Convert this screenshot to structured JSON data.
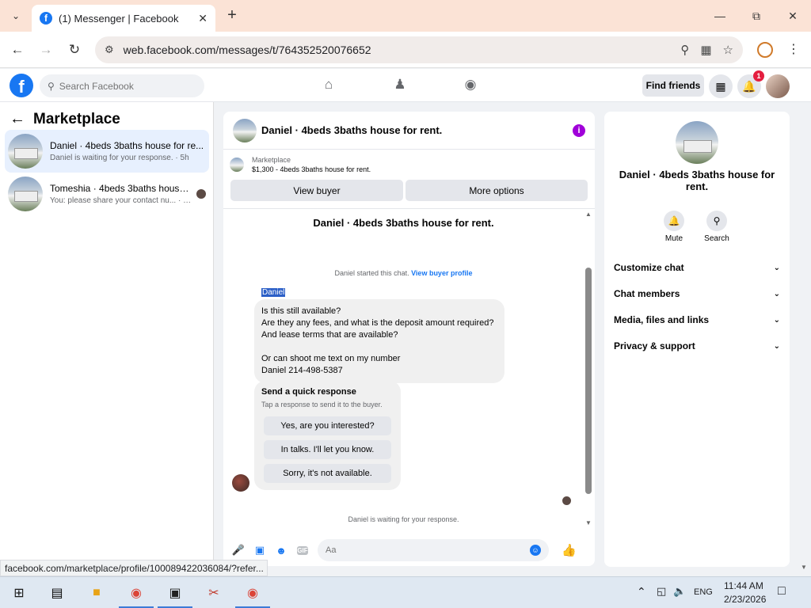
{
  "browser": {
    "tab_title": "(1) Messenger | Facebook",
    "url": "web.facebook.com/messages/t/764352520076652"
  },
  "header": {
    "search_placeholder": "Search Facebook",
    "find_friends": "Find friends",
    "notification_count": "1"
  },
  "sidebar": {
    "title": "Marketplace",
    "threads": [
      {
        "name": "Daniel · 4beds 3baths house for re...",
        "preview": "Daniel is waiting for your response. · 5h"
      },
      {
        "name": "Tomeshia · 4beds 3baths house ...",
        "preview": "You: please share your contact nu... · 2d"
      }
    ]
  },
  "chat": {
    "title": "Daniel · 4beds 3baths house for rent.",
    "listing_category": "Marketplace",
    "listing_desc": "$1,300 - 4beds 3baths house for rent.",
    "view_buyer": "View buyer",
    "more_options": "More options",
    "center_title": "Daniel · 4beds 3baths house for rent.",
    "started_text": "Daniel started this chat. ",
    "view_buyer_profile": "View buyer profile",
    "sender": "Daniel",
    "message_lines": [
      "Is this still available?",
      "Are they any fees, and what is the deposit amount required?",
      "And lease terms that are available?",
      "",
      "Or can shoot me text on my number",
      "Daniel 214-498-5387"
    ],
    "quick_title": "Send a quick response",
    "quick_sub": "Tap a response to send it to the buyer.",
    "quick_responses": [
      "Yes, are you interested?",
      "In talks. I'll let you know.",
      "Sorry, it's not available."
    ],
    "waiting": "Daniel is waiting for your response.",
    "input_placeholder": "Aa"
  },
  "right_panel": {
    "name": "Daniel · 4beds 3baths house for rent.",
    "mute": "Mute",
    "search": "Search",
    "sections": [
      "Customize chat",
      "Chat members",
      "Media, files and links",
      "Privacy & support"
    ]
  },
  "status_url": "facebook.com/marketplace/profile/100089422036084/?refer...",
  "taskbar": {
    "language": "ENG",
    "time": "11:44 AM",
    "date": "2/23/2026"
  },
  "colors": {
    "accent": "#1877f2",
    "tab_strip": "#fbe3d6",
    "info_purple": "#a000d9"
  }
}
